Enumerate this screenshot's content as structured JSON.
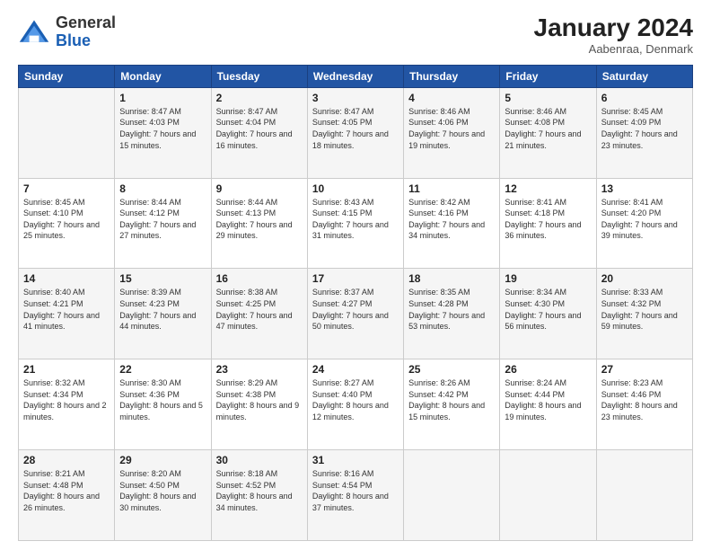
{
  "logo": {
    "general": "General",
    "blue": "Blue"
  },
  "header": {
    "month": "January 2024",
    "location": "Aabenraa, Denmark"
  },
  "weekdays": [
    "Sunday",
    "Monday",
    "Tuesday",
    "Wednesday",
    "Thursday",
    "Friday",
    "Saturday"
  ],
  "weeks": [
    [
      {
        "day": "",
        "sunrise": "",
        "sunset": "",
        "daylight": ""
      },
      {
        "day": "1",
        "sunrise": "Sunrise: 8:47 AM",
        "sunset": "Sunset: 4:03 PM",
        "daylight": "Daylight: 7 hours and 15 minutes."
      },
      {
        "day": "2",
        "sunrise": "Sunrise: 8:47 AM",
        "sunset": "Sunset: 4:04 PM",
        "daylight": "Daylight: 7 hours and 16 minutes."
      },
      {
        "day": "3",
        "sunrise": "Sunrise: 8:47 AM",
        "sunset": "Sunset: 4:05 PM",
        "daylight": "Daylight: 7 hours and 18 minutes."
      },
      {
        "day": "4",
        "sunrise": "Sunrise: 8:46 AM",
        "sunset": "Sunset: 4:06 PM",
        "daylight": "Daylight: 7 hours and 19 minutes."
      },
      {
        "day": "5",
        "sunrise": "Sunrise: 8:46 AM",
        "sunset": "Sunset: 4:08 PM",
        "daylight": "Daylight: 7 hours and 21 minutes."
      },
      {
        "day": "6",
        "sunrise": "Sunrise: 8:45 AM",
        "sunset": "Sunset: 4:09 PM",
        "daylight": "Daylight: 7 hours and 23 minutes."
      }
    ],
    [
      {
        "day": "7",
        "sunrise": "Sunrise: 8:45 AM",
        "sunset": "Sunset: 4:10 PM",
        "daylight": "Daylight: 7 hours and 25 minutes."
      },
      {
        "day": "8",
        "sunrise": "Sunrise: 8:44 AM",
        "sunset": "Sunset: 4:12 PM",
        "daylight": "Daylight: 7 hours and 27 minutes."
      },
      {
        "day": "9",
        "sunrise": "Sunrise: 8:44 AM",
        "sunset": "Sunset: 4:13 PM",
        "daylight": "Daylight: 7 hours and 29 minutes."
      },
      {
        "day": "10",
        "sunrise": "Sunrise: 8:43 AM",
        "sunset": "Sunset: 4:15 PM",
        "daylight": "Daylight: 7 hours and 31 minutes."
      },
      {
        "day": "11",
        "sunrise": "Sunrise: 8:42 AM",
        "sunset": "Sunset: 4:16 PM",
        "daylight": "Daylight: 7 hours and 34 minutes."
      },
      {
        "day": "12",
        "sunrise": "Sunrise: 8:41 AM",
        "sunset": "Sunset: 4:18 PM",
        "daylight": "Daylight: 7 hours and 36 minutes."
      },
      {
        "day": "13",
        "sunrise": "Sunrise: 8:41 AM",
        "sunset": "Sunset: 4:20 PM",
        "daylight": "Daylight: 7 hours and 39 minutes."
      }
    ],
    [
      {
        "day": "14",
        "sunrise": "Sunrise: 8:40 AM",
        "sunset": "Sunset: 4:21 PM",
        "daylight": "Daylight: 7 hours and 41 minutes."
      },
      {
        "day": "15",
        "sunrise": "Sunrise: 8:39 AM",
        "sunset": "Sunset: 4:23 PM",
        "daylight": "Daylight: 7 hours and 44 minutes."
      },
      {
        "day": "16",
        "sunrise": "Sunrise: 8:38 AM",
        "sunset": "Sunset: 4:25 PM",
        "daylight": "Daylight: 7 hours and 47 minutes."
      },
      {
        "day": "17",
        "sunrise": "Sunrise: 8:37 AM",
        "sunset": "Sunset: 4:27 PM",
        "daylight": "Daylight: 7 hours and 50 minutes."
      },
      {
        "day": "18",
        "sunrise": "Sunrise: 8:35 AM",
        "sunset": "Sunset: 4:28 PM",
        "daylight": "Daylight: 7 hours and 53 minutes."
      },
      {
        "day": "19",
        "sunrise": "Sunrise: 8:34 AM",
        "sunset": "Sunset: 4:30 PM",
        "daylight": "Daylight: 7 hours and 56 minutes."
      },
      {
        "day": "20",
        "sunrise": "Sunrise: 8:33 AM",
        "sunset": "Sunset: 4:32 PM",
        "daylight": "Daylight: 7 hours and 59 minutes."
      }
    ],
    [
      {
        "day": "21",
        "sunrise": "Sunrise: 8:32 AM",
        "sunset": "Sunset: 4:34 PM",
        "daylight": "Daylight: 8 hours and 2 minutes."
      },
      {
        "day": "22",
        "sunrise": "Sunrise: 8:30 AM",
        "sunset": "Sunset: 4:36 PM",
        "daylight": "Daylight: 8 hours and 5 minutes."
      },
      {
        "day": "23",
        "sunrise": "Sunrise: 8:29 AM",
        "sunset": "Sunset: 4:38 PM",
        "daylight": "Daylight: 8 hours and 9 minutes."
      },
      {
        "day": "24",
        "sunrise": "Sunrise: 8:27 AM",
        "sunset": "Sunset: 4:40 PM",
        "daylight": "Daylight: 8 hours and 12 minutes."
      },
      {
        "day": "25",
        "sunrise": "Sunrise: 8:26 AM",
        "sunset": "Sunset: 4:42 PM",
        "daylight": "Daylight: 8 hours and 15 minutes."
      },
      {
        "day": "26",
        "sunrise": "Sunrise: 8:24 AM",
        "sunset": "Sunset: 4:44 PM",
        "daylight": "Daylight: 8 hours and 19 minutes."
      },
      {
        "day": "27",
        "sunrise": "Sunrise: 8:23 AM",
        "sunset": "Sunset: 4:46 PM",
        "daylight": "Daylight: 8 hours and 23 minutes."
      }
    ],
    [
      {
        "day": "28",
        "sunrise": "Sunrise: 8:21 AM",
        "sunset": "Sunset: 4:48 PM",
        "daylight": "Daylight: 8 hours and 26 minutes."
      },
      {
        "day": "29",
        "sunrise": "Sunrise: 8:20 AM",
        "sunset": "Sunset: 4:50 PM",
        "daylight": "Daylight: 8 hours and 30 minutes."
      },
      {
        "day": "30",
        "sunrise": "Sunrise: 8:18 AM",
        "sunset": "Sunset: 4:52 PM",
        "daylight": "Daylight: 8 hours and 34 minutes."
      },
      {
        "day": "31",
        "sunrise": "Sunrise: 8:16 AM",
        "sunset": "Sunset: 4:54 PM",
        "daylight": "Daylight: 8 hours and 37 minutes."
      },
      {
        "day": "",
        "sunrise": "",
        "sunset": "",
        "daylight": ""
      },
      {
        "day": "",
        "sunrise": "",
        "sunset": "",
        "daylight": ""
      },
      {
        "day": "",
        "sunrise": "",
        "sunset": "",
        "daylight": ""
      }
    ]
  ]
}
